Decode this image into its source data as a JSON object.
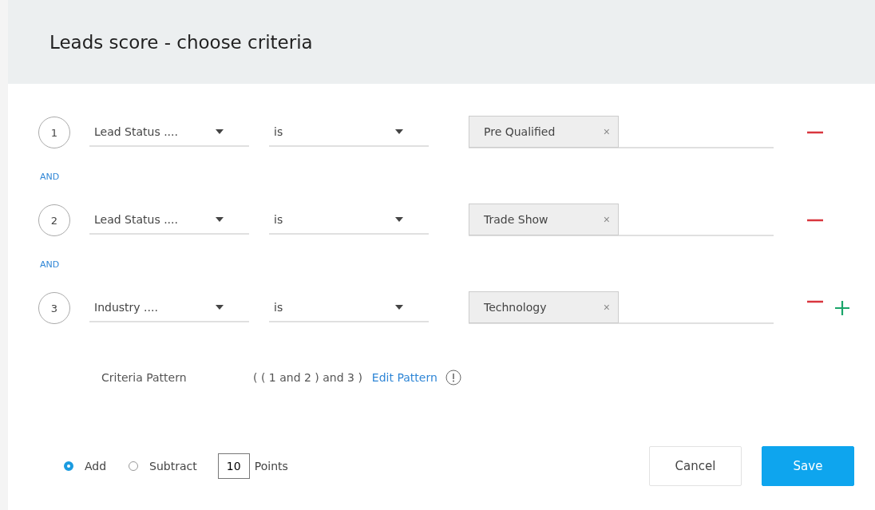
{
  "dialog": {
    "title": "Leads score - choose criteria"
  },
  "criteria": [
    {
      "number": "1",
      "field": "Lead Status ....",
      "operator": "is",
      "values": [
        "Pre Qualified"
      ],
      "remove_symbol": "×",
      "can_add": false
    },
    {
      "connector": "AND",
      "number": "2",
      "field": "Lead Status ....",
      "operator": "is",
      "values": [
        "Trade Show"
      ],
      "remove_symbol": "×",
      "can_add": false
    },
    {
      "connector": "AND",
      "number": "3",
      "field": "Industry ....",
      "operator": "is",
      "values": [
        "Technology"
      ],
      "remove_symbol": "×",
      "can_add": true
    }
  ],
  "pattern": {
    "label": "Criteria Pattern",
    "value": "( ( 1 and 2 ) and 3 )",
    "edit_link": "Edit Pattern"
  },
  "score_mode": [
    {
      "label": "Add",
      "selected": true
    },
    {
      "label": "Subtract",
      "selected": false
    }
  ],
  "points": {
    "value": "10",
    "label": "Points"
  },
  "buttons": [
    {
      "label": "Cancel",
      "kind": "secondary"
    },
    {
      "label": "Save",
      "kind": "primary"
    }
  ]
}
